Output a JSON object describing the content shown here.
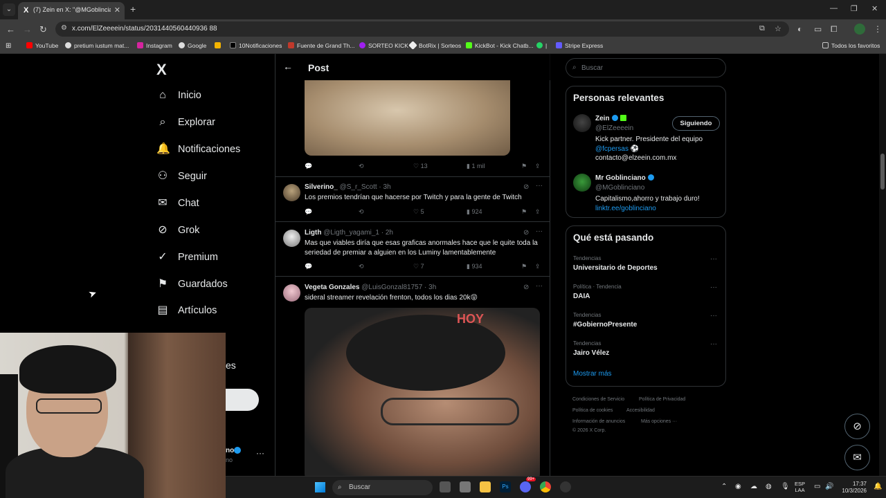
{
  "browser": {
    "tab_title": "(7) Zein en X: \"@MGoblinciano",
    "tab_favicon": "X",
    "url": "x.com/ElZeeeein/status/2031440560440936 88",
    "bookmarks": [
      "YouTube",
      "pretium iustum mat...",
      "Instagram",
      "Google",
      "",
      "10Notificaciones",
      "Fuente de Grand Th...",
      "SORTEO KICK",
      "BotRix | Sorteos",
      "KickBot - Kick Chatb...",
      "|",
      "Stripe Express"
    ],
    "bookmark_folder": "Todos los favoritos"
  },
  "nav": {
    "logo": "X",
    "items": [
      "Inicio",
      "Explorar",
      "Notificaciones",
      "Seguir",
      "Chat",
      "Grok",
      "Premium",
      "Guardados",
      "Artículos"
    ],
    "more_partial": "es",
    "account_name_partial": "no",
    "account_handle_partial": "no"
  },
  "timeline": {
    "header_title": "Post",
    "top_actions": {
      "likes": "13",
      "views": "1 mil"
    },
    "replies": [
      {
        "name": "Silverino_",
        "meta": "@S_r_Scott · 3h",
        "text": "Los premios tendrían que hacerse por Twitch y para la gente de Twitch",
        "likes": "5",
        "views": "924"
      },
      {
        "name": "Ligth",
        "meta": "@Ligth_yagami_1 · 2h",
        "text": "Mas que viables diría que esas graficas anormales hace que le quite toda la seriedad de premiar a alguien en los Luminy lamentablemente",
        "likes": "7",
        "views": "934"
      },
      {
        "name": "Vegeta Gonzales",
        "meta": "@LuisGonzal81757 · 3h",
        "text": "sideral streamer revelación frenton, todos los dias 20k😝"
      }
    ],
    "image_sign": "HOY"
  },
  "sidebar": {
    "search_placeholder": "Buscar",
    "relevant_title": "Personas relevantes",
    "people": [
      {
        "name": "Zein",
        "handle": "@ElZeeeein",
        "bio_line1": "Kick partner. Presidente del equipo",
        "bio_link": "@fcpersas",
        "bio_line2": " ⚽",
        "bio_line3": "contacto@elzeein.com.mx",
        "button": "Siguiendo"
      },
      {
        "name": "Mr Goblinciano",
        "handle": "@MGoblinciano",
        "bio_line1": "Capitalismo,ahorro y trabajo duro!",
        "bio_link": "linktr.ee/goblinciano"
      }
    ],
    "trends_title": "Qué está pasando",
    "trends": [
      {
        "category": "Tendencias",
        "name": "Universitario de Deportes"
      },
      {
        "category": "Política · Tendencia",
        "name": "DAIA"
      },
      {
        "category": "Tendencias",
        "name": "#GobiernoPresente"
      },
      {
        "category": "Tendencias",
        "name": "Jairo Vélez"
      }
    ],
    "show_more": "Mostrar más",
    "footer": [
      "Condiciones de Servicio",
      "Política de Privacidad",
      "Política de cookies",
      "Accesibilidad",
      "Información de anuncios",
      "Más opciones ···",
      "© 2026 X Corp."
    ]
  },
  "taskbar": {
    "search": "Buscar",
    "lang_line1": "ESP",
    "lang_line2": "LAA",
    "time": "17:37",
    "date": "10/3/2026",
    "badge": "99+"
  }
}
